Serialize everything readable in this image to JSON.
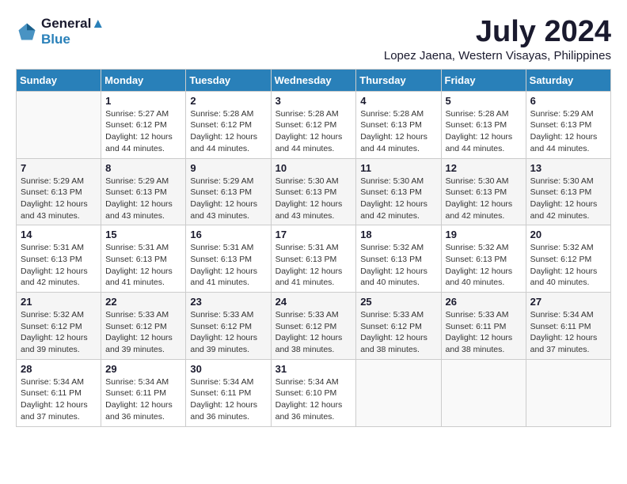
{
  "logo": {
    "line1": "General",
    "line2": "Blue"
  },
  "title": "July 2024",
  "subtitle": "Lopez Jaena, Western Visayas, Philippines",
  "headers": [
    "Sunday",
    "Monday",
    "Tuesday",
    "Wednesday",
    "Thursday",
    "Friday",
    "Saturday"
  ],
  "weeks": [
    [
      {
        "day": "",
        "sunrise": "",
        "sunset": "",
        "daylight": ""
      },
      {
        "day": "1",
        "sunrise": "Sunrise: 5:27 AM",
        "sunset": "Sunset: 6:12 PM",
        "daylight": "Daylight: 12 hours and 44 minutes."
      },
      {
        "day": "2",
        "sunrise": "Sunrise: 5:28 AM",
        "sunset": "Sunset: 6:12 PM",
        "daylight": "Daylight: 12 hours and 44 minutes."
      },
      {
        "day": "3",
        "sunrise": "Sunrise: 5:28 AM",
        "sunset": "Sunset: 6:12 PM",
        "daylight": "Daylight: 12 hours and 44 minutes."
      },
      {
        "day": "4",
        "sunrise": "Sunrise: 5:28 AM",
        "sunset": "Sunset: 6:13 PM",
        "daylight": "Daylight: 12 hours and 44 minutes."
      },
      {
        "day": "5",
        "sunrise": "Sunrise: 5:28 AM",
        "sunset": "Sunset: 6:13 PM",
        "daylight": "Daylight: 12 hours and 44 minutes."
      },
      {
        "day": "6",
        "sunrise": "Sunrise: 5:29 AM",
        "sunset": "Sunset: 6:13 PM",
        "daylight": "Daylight: 12 hours and 44 minutes."
      }
    ],
    [
      {
        "day": "7",
        "sunrise": "Sunrise: 5:29 AM",
        "sunset": "Sunset: 6:13 PM",
        "daylight": "Daylight: 12 hours and 43 minutes."
      },
      {
        "day": "8",
        "sunrise": "Sunrise: 5:29 AM",
        "sunset": "Sunset: 6:13 PM",
        "daylight": "Daylight: 12 hours and 43 minutes."
      },
      {
        "day": "9",
        "sunrise": "Sunrise: 5:29 AM",
        "sunset": "Sunset: 6:13 PM",
        "daylight": "Daylight: 12 hours and 43 minutes."
      },
      {
        "day": "10",
        "sunrise": "Sunrise: 5:30 AM",
        "sunset": "Sunset: 6:13 PM",
        "daylight": "Daylight: 12 hours and 43 minutes."
      },
      {
        "day": "11",
        "sunrise": "Sunrise: 5:30 AM",
        "sunset": "Sunset: 6:13 PM",
        "daylight": "Daylight: 12 hours and 42 minutes."
      },
      {
        "day": "12",
        "sunrise": "Sunrise: 5:30 AM",
        "sunset": "Sunset: 6:13 PM",
        "daylight": "Daylight: 12 hours and 42 minutes."
      },
      {
        "day": "13",
        "sunrise": "Sunrise: 5:30 AM",
        "sunset": "Sunset: 6:13 PM",
        "daylight": "Daylight: 12 hours and 42 minutes."
      }
    ],
    [
      {
        "day": "14",
        "sunrise": "Sunrise: 5:31 AM",
        "sunset": "Sunset: 6:13 PM",
        "daylight": "Daylight: 12 hours and 42 minutes."
      },
      {
        "day": "15",
        "sunrise": "Sunrise: 5:31 AM",
        "sunset": "Sunset: 6:13 PM",
        "daylight": "Daylight: 12 hours and 41 minutes."
      },
      {
        "day": "16",
        "sunrise": "Sunrise: 5:31 AM",
        "sunset": "Sunset: 6:13 PM",
        "daylight": "Daylight: 12 hours and 41 minutes."
      },
      {
        "day": "17",
        "sunrise": "Sunrise: 5:31 AM",
        "sunset": "Sunset: 6:13 PM",
        "daylight": "Daylight: 12 hours and 41 minutes."
      },
      {
        "day": "18",
        "sunrise": "Sunrise: 5:32 AM",
        "sunset": "Sunset: 6:13 PM",
        "daylight": "Daylight: 12 hours and 40 minutes."
      },
      {
        "day": "19",
        "sunrise": "Sunrise: 5:32 AM",
        "sunset": "Sunset: 6:13 PM",
        "daylight": "Daylight: 12 hours and 40 minutes."
      },
      {
        "day": "20",
        "sunrise": "Sunrise: 5:32 AM",
        "sunset": "Sunset: 6:12 PM",
        "daylight": "Daylight: 12 hours and 40 minutes."
      }
    ],
    [
      {
        "day": "21",
        "sunrise": "Sunrise: 5:32 AM",
        "sunset": "Sunset: 6:12 PM",
        "daylight": "Daylight: 12 hours and 39 minutes."
      },
      {
        "day": "22",
        "sunrise": "Sunrise: 5:33 AM",
        "sunset": "Sunset: 6:12 PM",
        "daylight": "Daylight: 12 hours and 39 minutes."
      },
      {
        "day": "23",
        "sunrise": "Sunrise: 5:33 AM",
        "sunset": "Sunset: 6:12 PM",
        "daylight": "Daylight: 12 hours and 39 minutes."
      },
      {
        "day": "24",
        "sunrise": "Sunrise: 5:33 AM",
        "sunset": "Sunset: 6:12 PM",
        "daylight": "Daylight: 12 hours and 38 minutes."
      },
      {
        "day": "25",
        "sunrise": "Sunrise: 5:33 AM",
        "sunset": "Sunset: 6:12 PM",
        "daylight": "Daylight: 12 hours and 38 minutes."
      },
      {
        "day": "26",
        "sunrise": "Sunrise: 5:33 AM",
        "sunset": "Sunset: 6:11 PM",
        "daylight": "Daylight: 12 hours and 38 minutes."
      },
      {
        "day": "27",
        "sunrise": "Sunrise: 5:34 AM",
        "sunset": "Sunset: 6:11 PM",
        "daylight": "Daylight: 12 hours and 37 minutes."
      }
    ],
    [
      {
        "day": "28",
        "sunrise": "Sunrise: 5:34 AM",
        "sunset": "Sunset: 6:11 PM",
        "daylight": "Daylight: 12 hours and 37 minutes."
      },
      {
        "day": "29",
        "sunrise": "Sunrise: 5:34 AM",
        "sunset": "Sunset: 6:11 PM",
        "daylight": "Daylight: 12 hours and 36 minutes."
      },
      {
        "day": "30",
        "sunrise": "Sunrise: 5:34 AM",
        "sunset": "Sunset: 6:11 PM",
        "daylight": "Daylight: 12 hours and 36 minutes."
      },
      {
        "day": "31",
        "sunrise": "Sunrise: 5:34 AM",
        "sunset": "Sunset: 6:10 PM",
        "daylight": "Daylight: 12 hours and 36 minutes."
      },
      {
        "day": "",
        "sunrise": "",
        "sunset": "",
        "daylight": ""
      },
      {
        "day": "",
        "sunrise": "",
        "sunset": "",
        "daylight": ""
      },
      {
        "day": "",
        "sunrise": "",
        "sunset": "",
        "daylight": ""
      }
    ]
  ]
}
